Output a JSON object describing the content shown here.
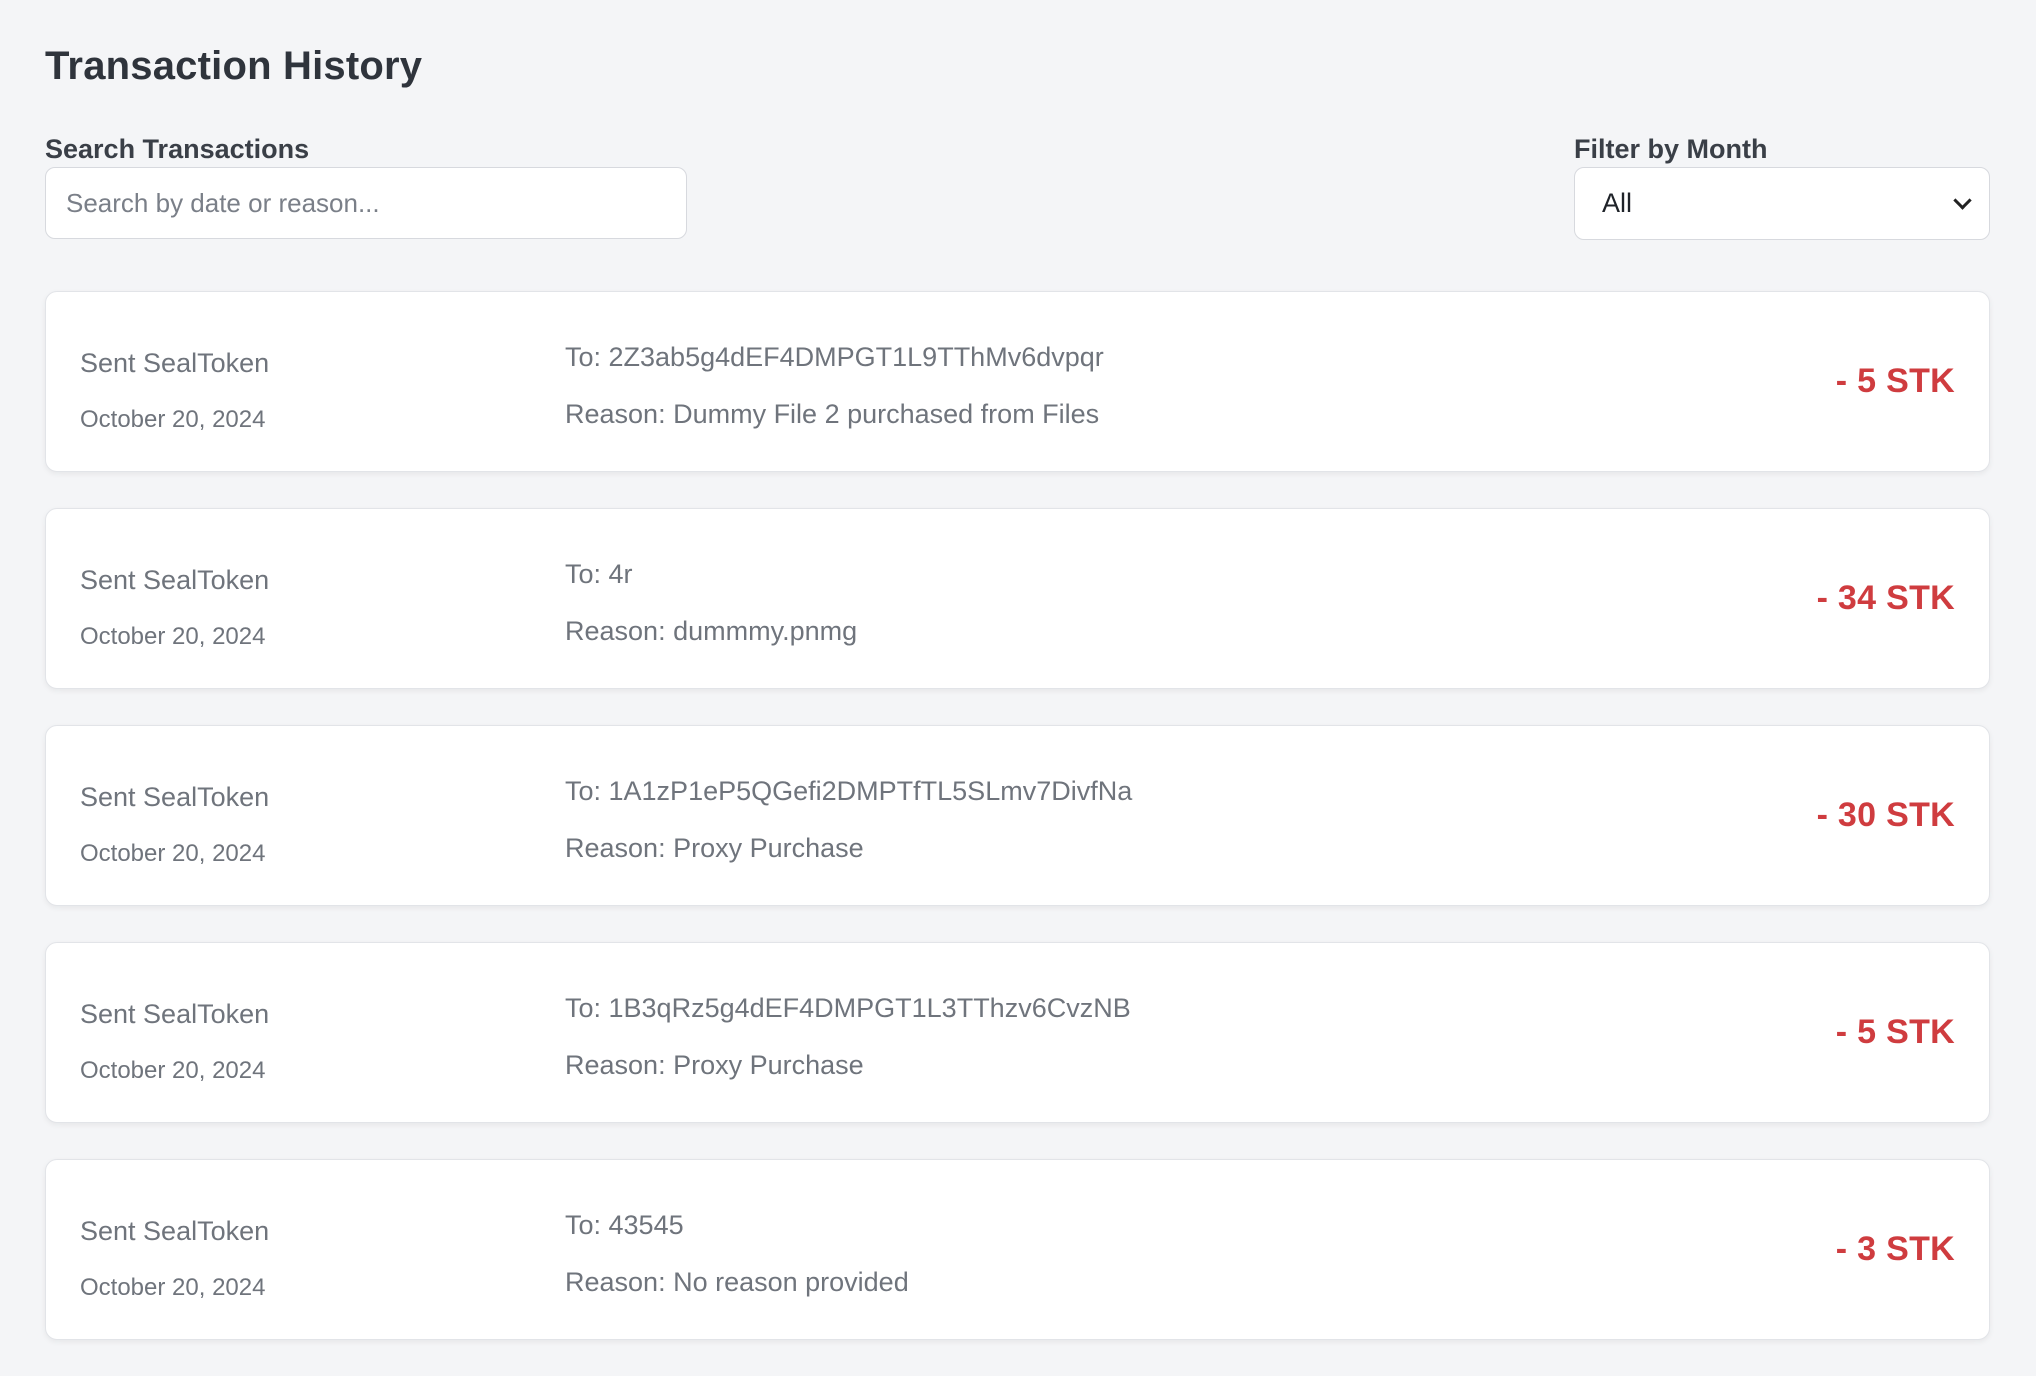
{
  "page": {
    "title": "Transaction History"
  },
  "search": {
    "label": "Search Transactions",
    "placeholder": "Search by date or reason...",
    "value": ""
  },
  "filter": {
    "label": "Filter by Month",
    "selected": "All"
  },
  "colors": {
    "amount_negative": "#cf3c3f",
    "background": "#f4f5f7",
    "card": "#ffffff"
  },
  "transactions": [
    {
      "type": "Sent SealToken",
      "date": "October 20, 2024",
      "to": "To: 2Z3ab5g4dEF4DMPGT1L9TThMv6dvpqr",
      "reason": "Reason: Dummy File 2 purchased from Files",
      "amount": "- 5 STK"
    },
    {
      "type": "Sent SealToken",
      "date": "October 20, 2024",
      "to": "To: 4r",
      "reason": "Reason: dummmy.pnmg",
      "amount": "- 34 STK"
    },
    {
      "type": "Sent SealToken",
      "date": "October 20, 2024",
      "to": "To: 1A1zP1eP5QGefi2DMPTfTL5SLmv7DivfNa",
      "reason": "Reason: Proxy Purchase",
      "amount": "- 30 STK"
    },
    {
      "type": "Sent SealToken",
      "date": "October 20, 2024",
      "to": "To: 1B3qRz5g4dEF4DMPGT1L3TThzv6CvzNB",
      "reason": "Reason: Proxy Purchase",
      "amount": "- 5 STK"
    },
    {
      "type": "Sent SealToken",
      "date": "October 20, 2024",
      "to": "To: 43545",
      "reason": "Reason: No reason provided",
      "amount": "- 3 STK"
    }
  ]
}
